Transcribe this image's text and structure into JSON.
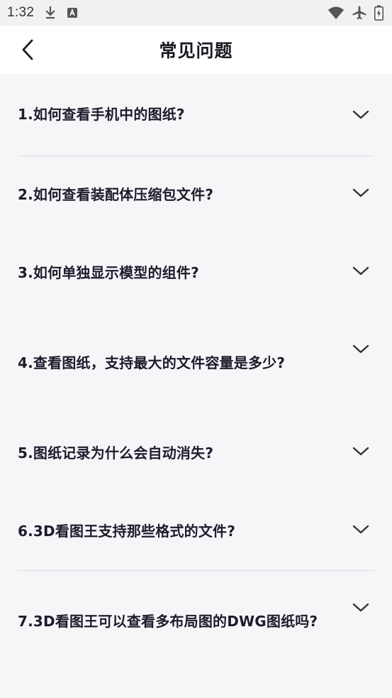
{
  "status_bar": {
    "time": "1:32",
    "icons": [
      "download-icon",
      "text-a-icon",
      "wifi-icon",
      "airplane-icon",
      "battery-icon"
    ]
  },
  "header": {
    "title": "常见问题",
    "back_icon": "chevron-left-icon"
  },
  "faq": {
    "expand_icon": "chevron-down-icon",
    "items": [
      {
        "question": "1.如何查看手机中的图纸?"
      },
      {
        "question": "2.如何查看装配体压缩包文件?"
      },
      {
        "question": "3.如何单独显示模型的组件?"
      },
      {
        "question": "4.查看图纸，支持最大的文件容量是多少?"
      },
      {
        "question": "5.图纸记录为什么会自动消失?"
      },
      {
        "question": "6.3D看图王支持那些格式的文件?"
      },
      {
        "question": "7.3D看图王可以查看多布局图的DWG图纸吗?"
      }
    ]
  },
  "colors": {
    "background": "#f6f6f8",
    "header": "#ffffff",
    "text": "#1a1a2a",
    "divider": "#dcdce2"
  }
}
